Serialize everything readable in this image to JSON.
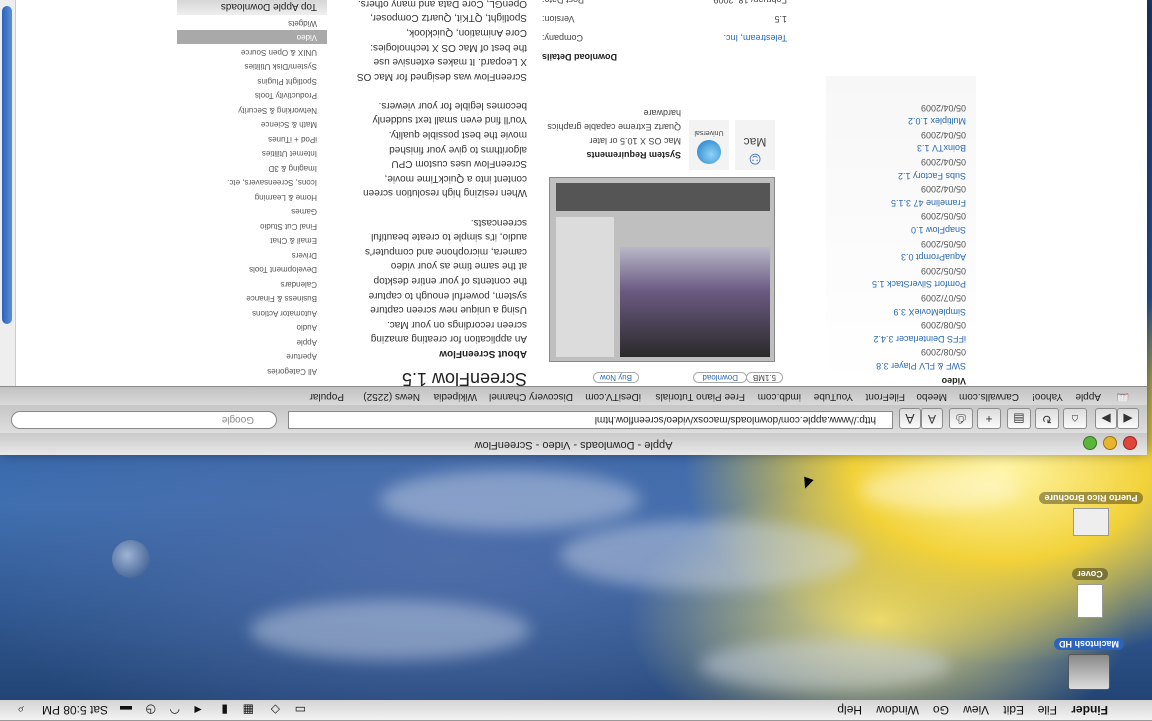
{
  "browser": {
    "title": "Apple - Downloads - Video - ScreenFlow",
    "url": "http://www.apple.com/downloads/macosx/video/screenflow.html",
    "search_placeholder": "Google",
    "bookmarks": [
      "Apple",
      "Yahoo!",
      "Carwalls.com",
      "Meebo",
      "FileFront",
      "YouTube",
      "imdb.com",
      "Free Piano Tutorials",
      "iDesiTV.com",
      "Discovery Channel",
      "Wikipedia",
      "News (2252)",
      "Popular"
    ]
  },
  "page": {
    "sidebar_heading": "Top Apple Downloads",
    "categories": [
      "Widgets",
      "Video",
      "UNIX & Open Source",
      "System/Disk Utilities",
      "Spotlight Plugins",
      "Productivity Tools",
      "Networking & Security",
      "Math & Science",
      "iPod + iTunes",
      "Internet Utilities",
      "Imaging & 3D",
      "Icons, Screensavers, etc.",
      "Home & Learning",
      "Games",
      "Final Cut Studio",
      "Email & Chat",
      "Drivers",
      "Development Tools",
      "Calendars",
      "Business & Finance",
      "Automator Actions",
      "Audio",
      "Apple",
      "Aperture",
      "All Categories"
    ],
    "selected_category": "Video",
    "product_title": "ScreenFlow 1.5",
    "about_heading": "About ScreenFlow",
    "description": [
      "An application for creating amazing",
      "screen recordings on your Mac.",
      "Using a unique new screen capture",
      "system, powerful enough to capture",
      "the contents of your entire desktop",
      "at the same time as your video",
      "camera, microphone and computer's",
      "audio, it's simple to create beautiful",
      "screencasts.",
      "",
      "When resizing high resolution screen",
      "content into a QuickTime movie,",
      "ScreenFlow uses custom CPU",
      "algorithms to give your finished",
      "movie the best possible quality.",
      "You'll find even small text suddenly",
      "becomes legible for your viewers.",
      "",
      "ScreenFlow was designed for Mac OS",
      "X Leopard. It makes extensive use",
      "the best of Mac OS X technologies:",
      "Core Animation, Quicklook,",
      "Spotlight, QTKit, Quartz Composer,",
      "OpenGL, Core Data and many others."
    ],
    "download_label": "Download",
    "download_size": "5.1MB",
    "buy_label": "Buy Now",
    "sysreq_heading": "System Requirements",
    "sysreq": [
      "Mac OS X 10.5 or later",
      "Quartz Extreme capable graphics",
      "hardware"
    ],
    "details_heading": "Download Details",
    "details": [
      {
        "label": "Company:",
        "value": "Telestream, Inc."
      },
      {
        "label": "Version:",
        "value": "1.5"
      },
      {
        "label": "Post Date:",
        "value": "February 18, 2009"
      }
    ],
    "badge_mac": "Mac",
    "badge_universal": "Universal",
    "news_heading": "Video",
    "news": [
      {
        "title": "SWF & FLV Player 3.8",
        "date": "05/08/2009"
      },
      {
        "title": "iFFS Deinterlacer 3.4.2",
        "date": "05/08/2009"
      },
      {
        "title": "SimpleMovieX 3.9",
        "date": "05/07/2009"
      },
      {
        "title": "Pomfort SilverStack 1.5",
        "date": "05/05/2009"
      },
      {
        "title": "AquaPrompt 0.3",
        "date": "05/05/2009"
      },
      {
        "title": "SnapFlow 1.0",
        "date": "05/05/2009"
      },
      {
        "title": "Frameline 47 3.1.5",
        "date": "05/04/2009"
      },
      {
        "title": "Subs Factory 1.2",
        "date": "05/04/2009"
      },
      {
        "title": "BoinxTV 1.3",
        "date": "05/04/2009"
      },
      {
        "title": "Multiplex 1.0.2",
        "date": "05/04/2009"
      }
    ]
  },
  "menubar": {
    "app": "Finder",
    "menus": [
      "File",
      "Edit",
      "View",
      "Go",
      "Window",
      "Help"
    ],
    "clock": "Sat 5:08 PM"
  },
  "desktop": {
    "icons": [
      "Macintosh HD",
      "Cover",
      "Puerto Rico Brochure"
    ]
  },
  "colors": {
    "accent": "#2b63bd",
    "link": "#2a6ab0"
  }
}
